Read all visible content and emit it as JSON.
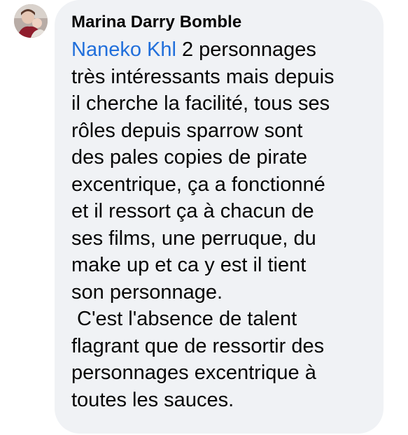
{
  "comment": {
    "author": "Marina Darry Bomble",
    "mention": "Naneko Khl",
    "lines": [
      " 2 personnages",
      "très intéressants mais depuis",
      "il cherche la facilité, tous ses",
      "rôles depuis sparrow sont",
      "des pales copies de pirate",
      "excentrique, ça a fonctionné",
      "et il ressort ça à chacun de",
      "ses films, une perruque, du",
      "make up et ca y est il tient",
      "son personnage.",
      " C'est l'absence de talent",
      "flagrant que de ressortir des",
      "personnages excentrique à",
      "toutes les sauces."
    ]
  },
  "colors": {
    "bubble": "#f0f2f5",
    "mention": "#216fdb",
    "text": "#050505"
  },
  "icons": {
    "avatar": "profile-photo"
  }
}
